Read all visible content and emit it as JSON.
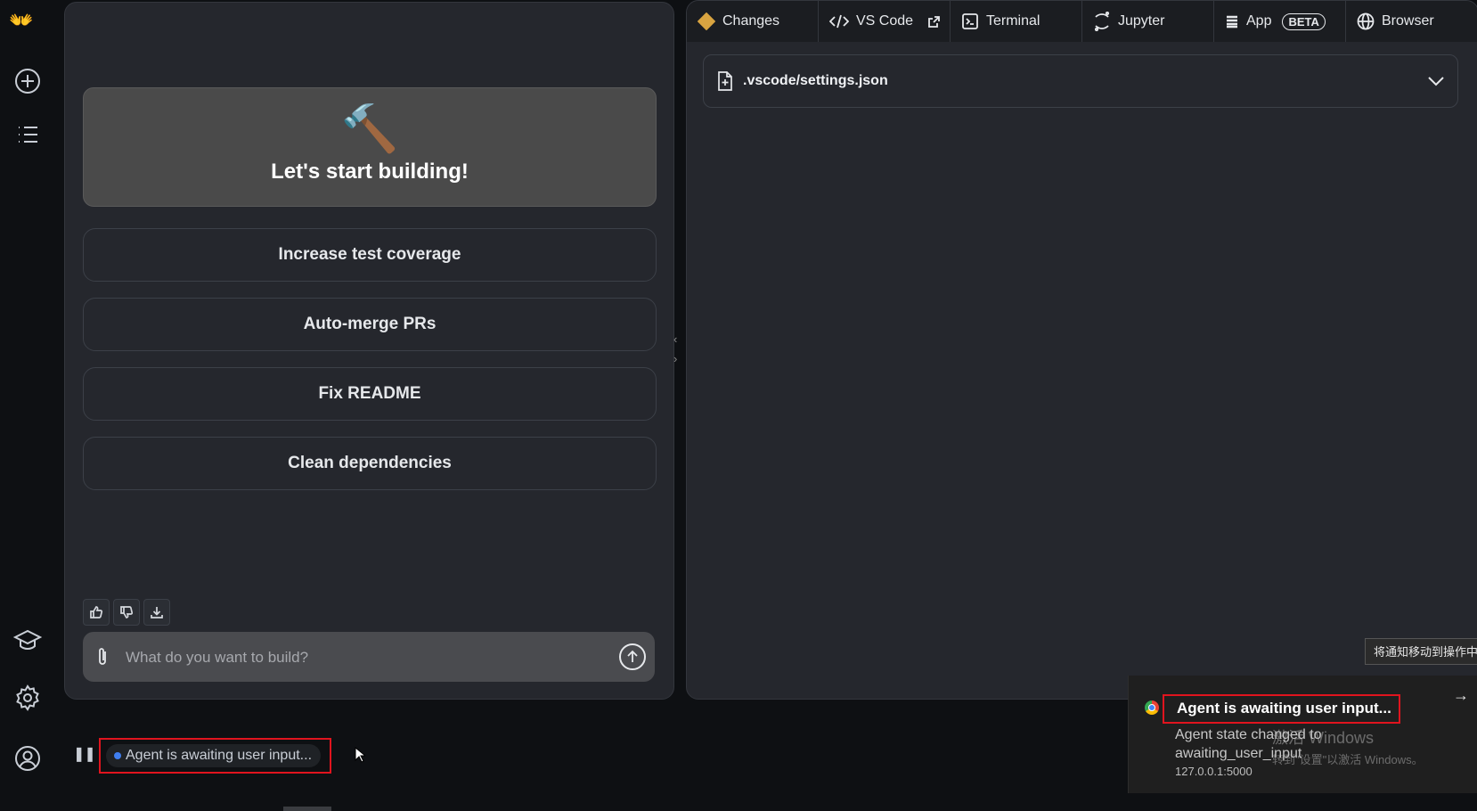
{
  "rail": {
    "logo": "👐"
  },
  "chat": {
    "hero_emoji": "🔨",
    "hero_title": "Let's start building!",
    "suggestions": [
      "Increase test coverage",
      "Auto-merge PRs",
      "Fix README",
      "Clean dependencies"
    ],
    "input_placeholder": "What do you want to build?"
  },
  "workspace": {
    "tabs": [
      {
        "label": "Changes",
        "icon": "changes-icon"
      },
      {
        "label": "VS Code",
        "icon": "code-icon"
      },
      {
        "label": "Terminal",
        "icon": "terminal-icon"
      },
      {
        "label": "Jupyter",
        "icon": "jupyter-icon"
      },
      {
        "label": "App",
        "icon": "app-icon",
        "badge": "BETA"
      },
      {
        "label": "Browser",
        "icon": "globe-icon"
      }
    ],
    "file_name": ".vscode/settings.json"
  },
  "status": {
    "text": "Agent is awaiting user input..."
  },
  "notification": {
    "tooltip": "将通知移动到操作中心",
    "title": "Agent is awaiting user input...",
    "body": "Agent state changed to awaiting_user_input",
    "host": "127.0.0.1:5000",
    "watermark": "激活 Windows",
    "watermark_sub": "转到\"设置\"以激活 Windows。"
  },
  "colors": {
    "background": "#0e1013",
    "panel": "#25272d",
    "status_dot": "#3f7ef0",
    "highlight_box": "#e0141e"
  }
}
